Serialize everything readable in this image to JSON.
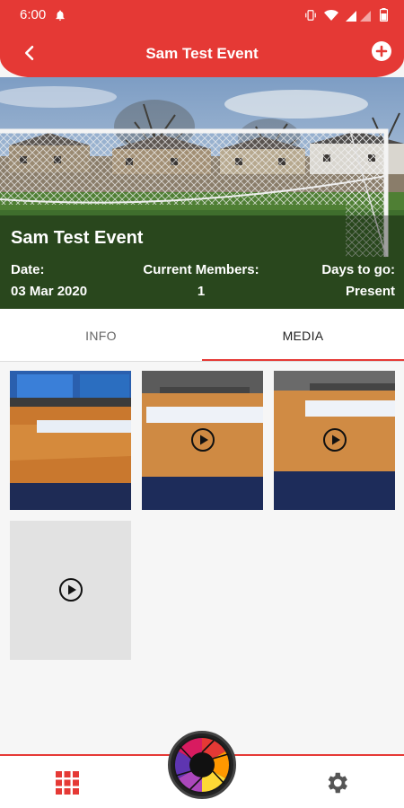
{
  "status_bar": {
    "time": "6:00",
    "icons": [
      "bell-icon",
      "vibrate-icon",
      "wifi-icon",
      "signal-icon",
      "battery-icon"
    ]
  },
  "header": {
    "title": "Sam Test Event",
    "back_icon": "chevron-left-icon",
    "add_icon": "add-circle-icon"
  },
  "banner": {
    "event_name": "Sam Test Event",
    "stats": [
      {
        "label": "Date:",
        "value": "03 Mar 2020"
      },
      {
        "label": "Current Members:",
        "value": "1"
      },
      {
        "label": "Days to go:",
        "value": "Present"
      }
    ]
  },
  "tabs": [
    {
      "label": "INFO",
      "active": false
    },
    {
      "label": "MEDIA",
      "active": true
    }
  ],
  "media": [
    {
      "type": "photo"
    },
    {
      "type": "video"
    },
    {
      "type": "video"
    },
    {
      "type": "video",
      "placeholder": true
    }
  ],
  "bottom_nav": {
    "left_icon": "grid-icon",
    "center_icon": "camera-shutter-icon",
    "right_icon": "gear-icon"
  },
  "colors": {
    "accent": "#e53935",
    "background": "#f6f6f6"
  }
}
